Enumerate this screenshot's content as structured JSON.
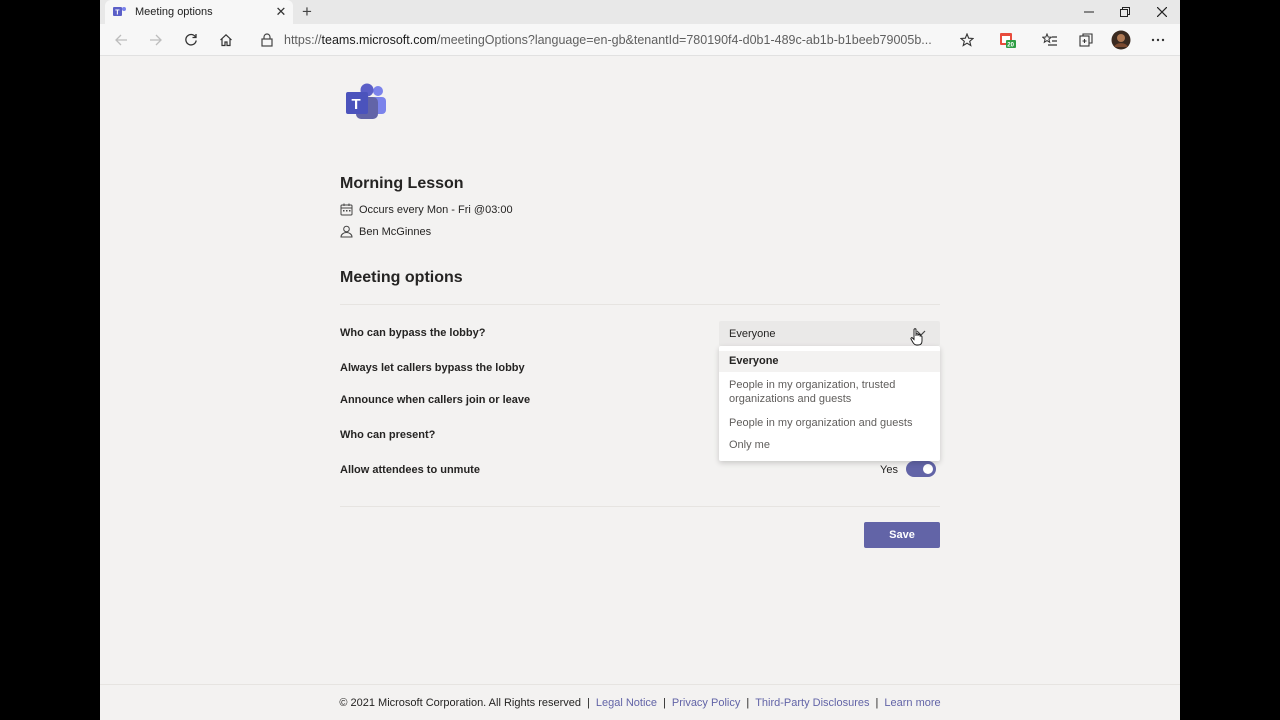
{
  "browser": {
    "tab_title": "Meeting options",
    "url_prefix": "https://",
    "url_host": "teams.microsoft.com",
    "url_path": "/meetingOptions?language=en-gb&tenantId=780190f4-d0b1-489c-ab1b-b1beeb79005b...",
    "extension_badge": "20"
  },
  "meeting": {
    "title": "Morning Lesson",
    "recurrence": "Occurs every Mon - Fri @03:00",
    "organizer": "Ben McGinnes"
  },
  "options": {
    "section_title": "Meeting options",
    "lobby_label": "Who can bypass the lobby?",
    "callers_label": "Always let callers bypass the lobby",
    "announce_label": "Announce when callers join or leave",
    "present_label": "Who can present?",
    "unmute_label": "Allow attendees to unmute",
    "lobby_selected": "Everyone",
    "lobby_options": [
      "Everyone",
      "People in my organization, trusted organizations and guests",
      "People in my organization and guests",
      "Only me"
    ],
    "unmute_value": "Yes",
    "unmute_on": true
  },
  "actions": {
    "save_label": "Save"
  },
  "footer": {
    "copyright": "© 2021 Microsoft Corporation. All Rights reserved",
    "legal": "Legal Notice",
    "privacy": "Privacy Policy",
    "third_party": "Third-Party Disclosures",
    "learn_more": "Learn more"
  },
  "colors": {
    "brand": "#6264a7",
    "page_bg": "#f3f2f1"
  }
}
